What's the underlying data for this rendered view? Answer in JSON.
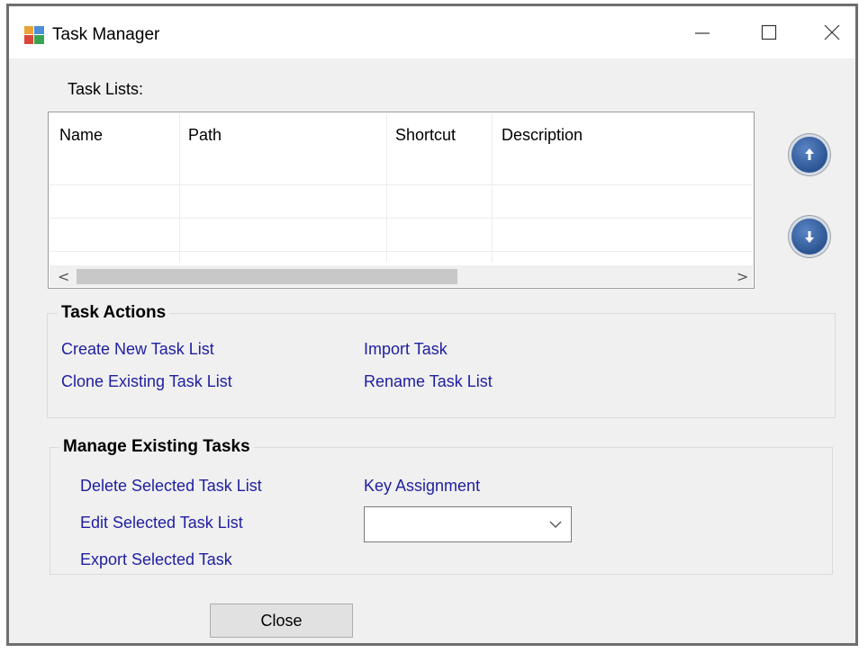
{
  "window": {
    "title": "Task Manager",
    "controls": {
      "minimize_icon": "minimize-icon",
      "maximize_icon": "maximize-icon",
      "close_icon": "close-icon"
    }
  },
  "task_lists": {
    "label": "Task Lists:",
    "columns": [
      "Name",
      "Path",
      "Shortcut",
      "Description"
    ],
    "rows": [],
    "scroll_left": "<",
    "scroll_right": ">"
  },
  "move_buttons": {
    "up_icon": "arrow-up-icon",
    "down_icon": "arrow-down-icon"
  },
  "task_actions": {
    "title": "Task Actions",
    "create_new": "Create New Task List",
    "clone_existing": "Clone Existing Task List",
    "import_task": "Import Task",
    "rename": "Rename Task List"
  },
  "manage_tasks": {
    "title": "Manage Existing Tasks",
    "delete_selected": "Delete Selected Task List",
    "edit_selected": "Edit Selected Task List",
    "export_selected": "Export Selected Task",
    "key_assignment_label": "Key Assignment",
    "key_assignment_value": ""
  },
  "footer": {
    "close_label": "Close"
  },
  "colors": {
    "link": "#1e1ea0",
    "accent_button": "#2b5592",
    "window_bg": "#f0f0f0"
  }
}
